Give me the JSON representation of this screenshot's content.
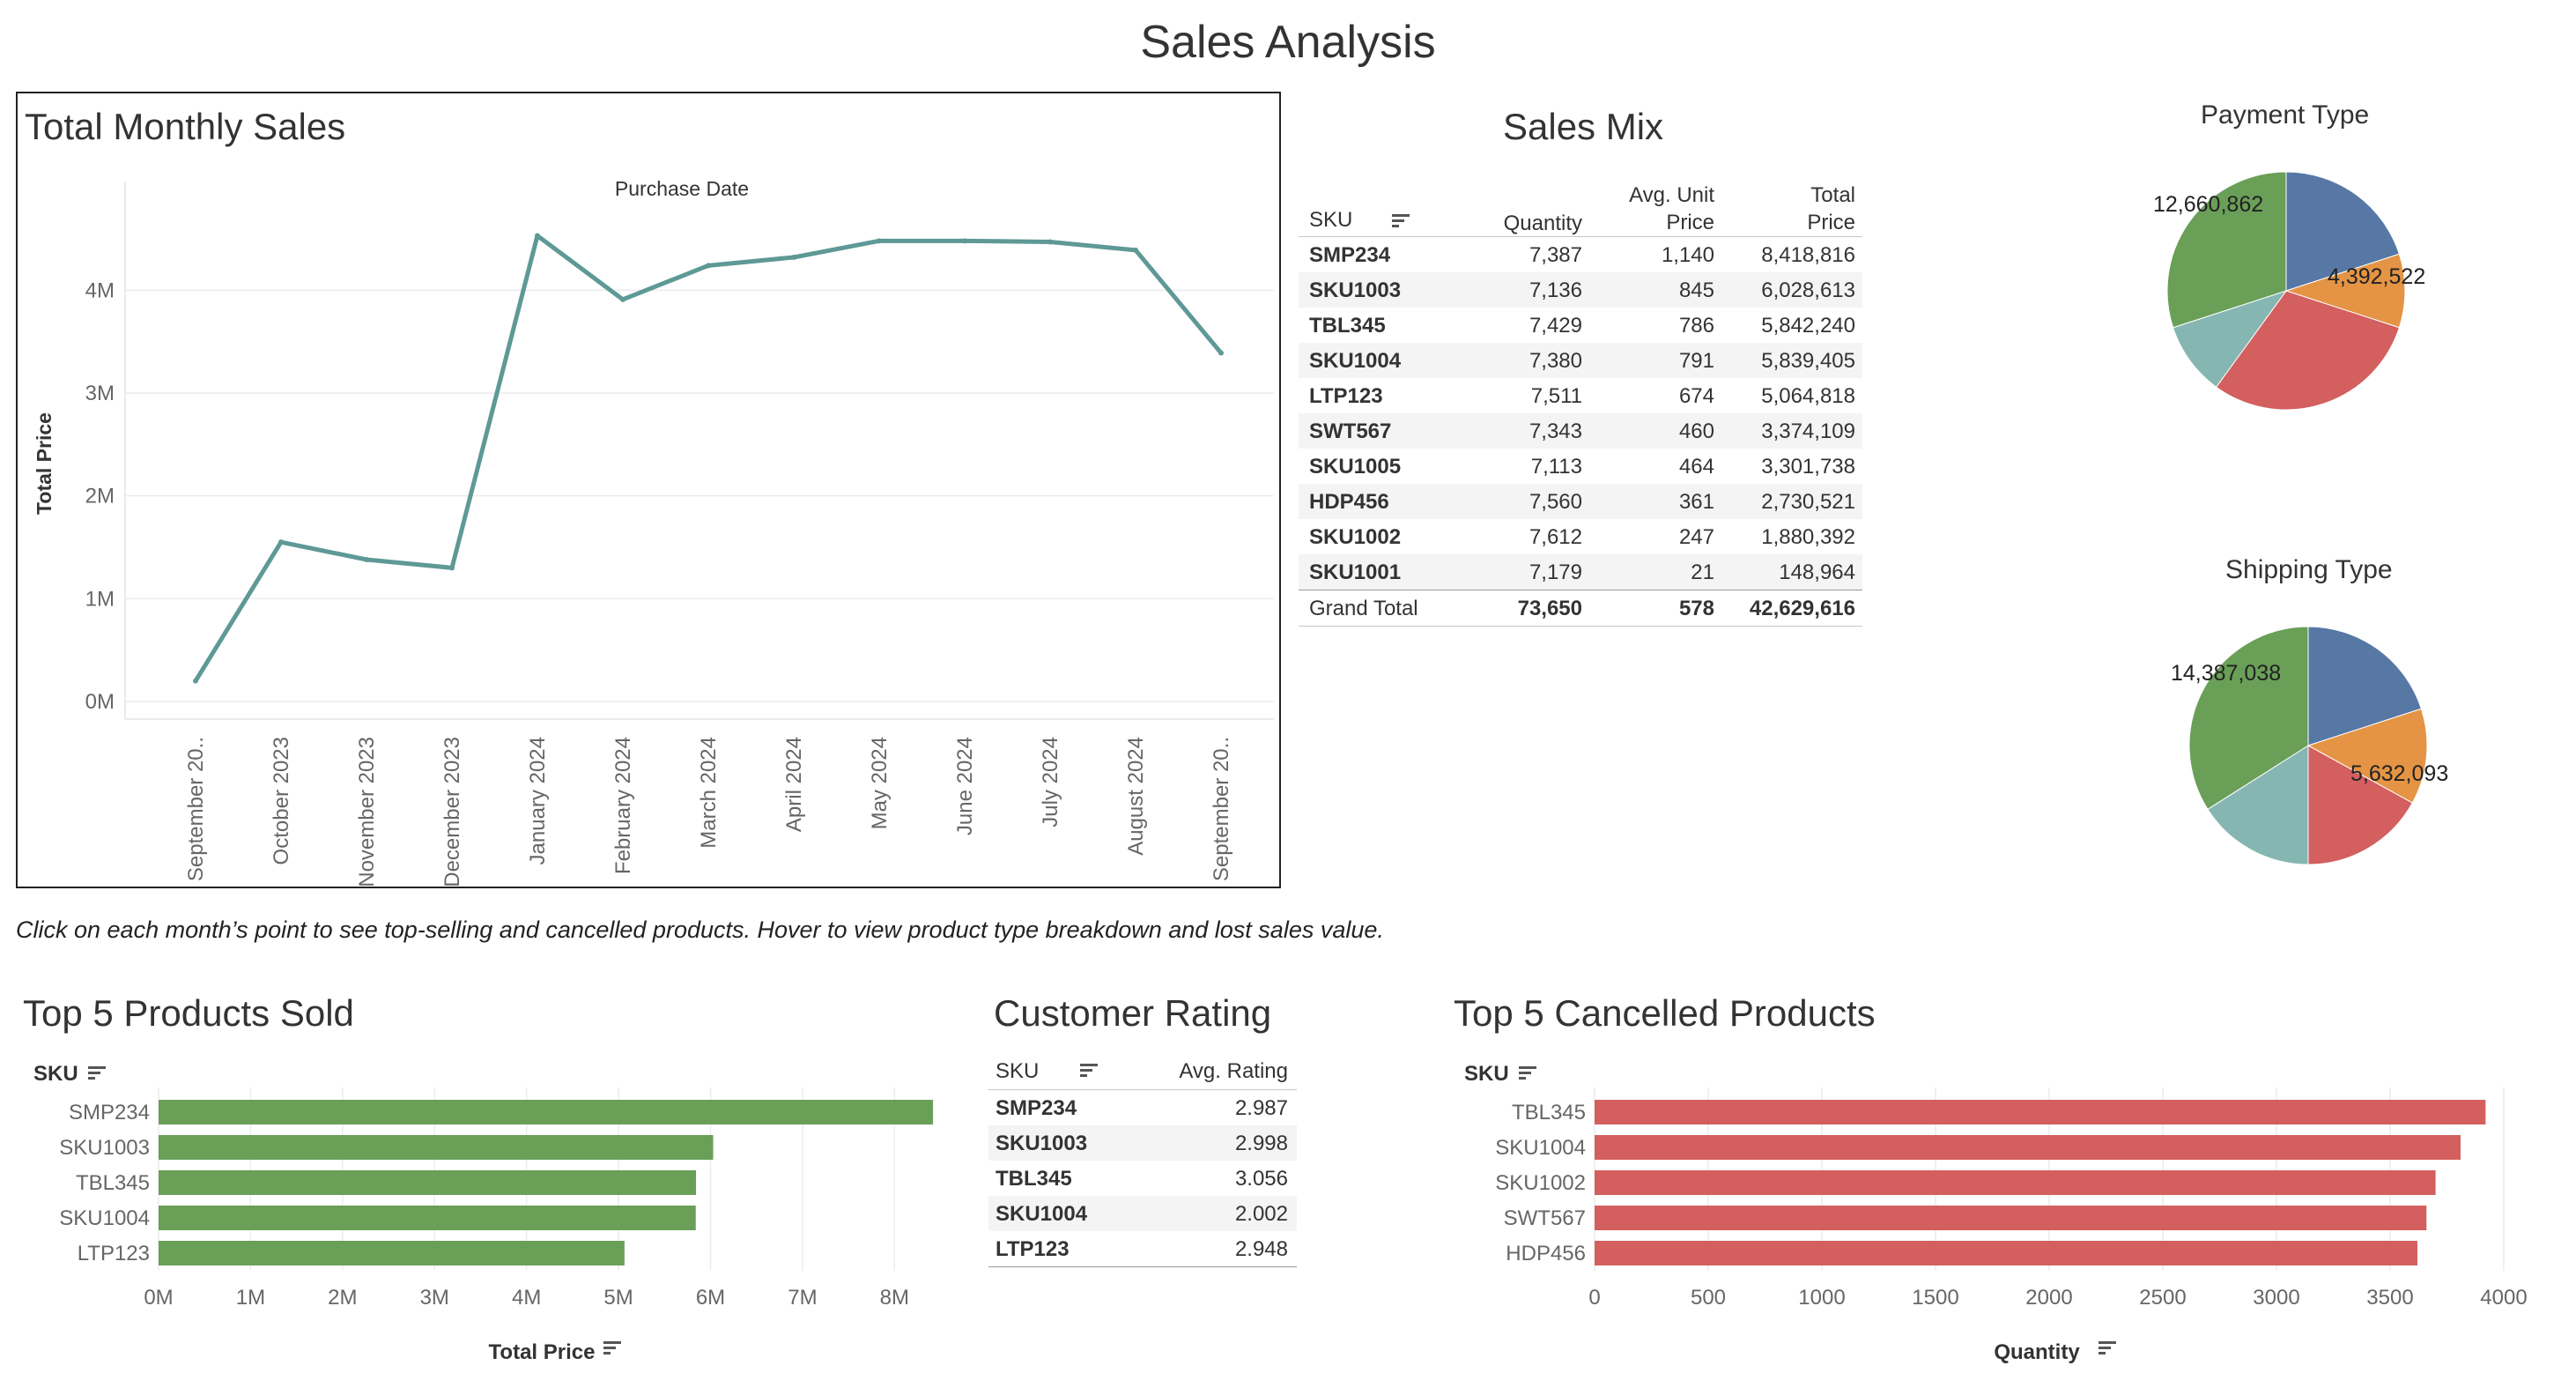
{
  "page_title": "Sales Analysis",
  "note": "Click on each month’s point to see top-selling and cancelled products. Hover to view product type breakdown and lost sales value.",
  "colors": {
    "line": "#5e9996",
    "green": "#6a9f58",
    "red": "#d35f5f",
    "blue": "#5778a4",
    "orange": "#e49444",
    "teal": "#85b6b2",
    "grid": "#ececec",
    "axis_text": "#666666"
  },
  "icons": [
    "sort-icon"
  ],
  "monthly": {
    "title": "Total Monthly Sales",
    "chart_data": {
      "type": "line",
      "title": "Purchase Date",
      "xlabel": "Purchase Date",
      "ylabel": "Total Price",
      "categories": [
        "September 20..",
        "October 2023",
        "November 2023",
        "December 2023",
        "January 2024",
        "February 2024",
        "March 2024",
        "April 2024",
        "May 2024",
        "June 2024",
        "July 2024",
        "August 2024",
        "September 20.."
      ],
      "values": [
        200000,
        1550000,
        1380000,
        1300000,
        4530000,
        3910000,
        4240000,
        4320000,
        4480000,
        4480000,
        4470000,
        4390000,
        3390000
      ],
      "yticks": [
        "0M",
        "1M",
        "2M",
        "3M",
        "4M"
      ],
      "ylim": [
        0,
        4800000
      ],
      "grid": true
    }
  },
  "sales_mix": {
    "title": "Sales Mix",
    "headers": {
      "sku": "SKU",
      "qty": "Quantity",
      "avg1": "Avg. Unit",
      "avg2": "Price",
      "tot1": "Total",
      "tot2": "Price"
    },
    "rows": [
      {
        "sku": "SMP234",
        "qty": "7,387",
        "avg": "1,140",
        "total": "8,418,816"
      },
      {
        "sku": "SKU1003",
        "qty": "7,136",
        "avg": "845",
        "total": "6,028,613"
      },
      {
        "sku": "TBL345",
        "qty": "7,429",
        "avg": "786",
        "total": "5,842,240"
      },
      {
        "sku": "SKU1004",
        "qty": "7,380",
        "avg": "791",
        "total": "5,839,405"
      },
      {
        "sku": "LTP123",
        "qty": "7,511",
        "avg": "674",
        "total": "5,064,818"
      },
      {
        "sku": "SWT567",
        "qty": "7,343",
        "avg": "460",
        "total": "3,374,109"
      },
      {
        "sku": "SKU1005",
        "qty": "7,113",
        "avg": "464",
        "total": "3,301,738"
      },
      {
        "sku": "HDP456",
        "qty": "7,560",
        "avg": "361",
        "total": "2,730,521"
      },
      {
        "sku": "SKU1002",
        "qty": "7,612",
        "avg": "247",
        "total": "1,880,392"
      },
      {
        "sku": "SKU1001",
        "qty": "7,179",
        "avg": "21",
        "total": "148,964"
      }
    ],
    "grand_total": {
      "label": "Grand Total",
      "qty": "73,650",
      "avg": "578",
      "total": "42,629,616"
    }
  },
  "payment": {
    "title": "Payment Type",
    "chart_data": {
      "type": "pie",
      "slices": [
        {
          "value": 0.2,
          "color": "#5778a4"
        },
        {
          "value": 0.1,
          "color": "#e49444",
          "label": "4,392,522"
        },
        {
          "value": 0.3,
          "color": "#d35f5f"
        },
        {
          "value": 0.1,
          "color": "#85b6b2"
        },
        {
          "value": 0.3,
          "color": "#6a9f58",
          "label": "12,660,862"
        }
      ]
    }
  },
  "shipping": {
    "title": "Shipping Type",
    "chart_data": {
      "type": "pie",
      "slices": [
        {
          "value": 0.2,
          "color": "#5778a4"
        },
        {
          "value": 0.13,
          "color": "#e49444",
          "label": "5,632,093"
        },
        {
          "value": 0.17,
          "color": "#d35f5f"
        },
        {
          "value": 0.16,
          "color": "#85b6b2"
        },
        {
          "value": 0.34,
          "color": "#6a9f58",
          "label": "14,387,038"
        }
      ]
    }
  },
  "top5": {
    "title": "Top 5 Products Sold",
    "sku_label": "SKU",
    "chart_data": {
      "type": "bar",
      "categories": [
        "SMP234",
        "SKU1003",
        "TBL345",
        "SKU1004",
        "LTP123"
      ],
      "values": [
        8418816,
        6028613,
        5842240,
        5839405,
        5064818
      ],
      "xlabel": "Total Price",
      "xticks": [
        "0M",
        "1M",
        "2M",
        "3M",
        "4M",
        "5M",
        "6M",
        "7M",
        "8M"
      ],
      "xlim": [
        0,
        8600000
      ]
    }
  },
  "rating": {
    "title": "Customer Rating",
    "headers": {
      "sku": "SKU",
      "avg": "Avg. Rating"
    },
    "rows": [
      {
        "sku": "SMP234",
        "avg": "2.987"
      },
      {
        "sku": "SKU1003",
        "avg": "2.998"
      },
      {
        "sku": "TBL345",
        "avg": "3.056"
      },
      {
        "sku": "SKU1004",
        "avg": "2.002"
      },
      {
        "sku": "LTP123",
        "avg": "2.948"
      }
    ]
  },
  "cancelled": {
    "title": "Top 5 Cancelled Products",
    "sku_label": "SKU",
    "chart_data": {
      "type": "bar",
      "categories": [
        "TBL345",
        "SKU1004",
        "SKU1002",
        "SWT567",
        "HDP456"
      ],
      "values": [
        3920,
        3810,
        3700,
        3660,
        3620
      ],
      "xlabel": "Quantity",
      "xticks": [
        "0",
        "500",
        "1000",
        "1500",
        "2000",
        "2500",
        "3000",
        "3500",
        "4000"
      ],
      "xlim": [
        0,
        4000
      ]
    }
  }
}
